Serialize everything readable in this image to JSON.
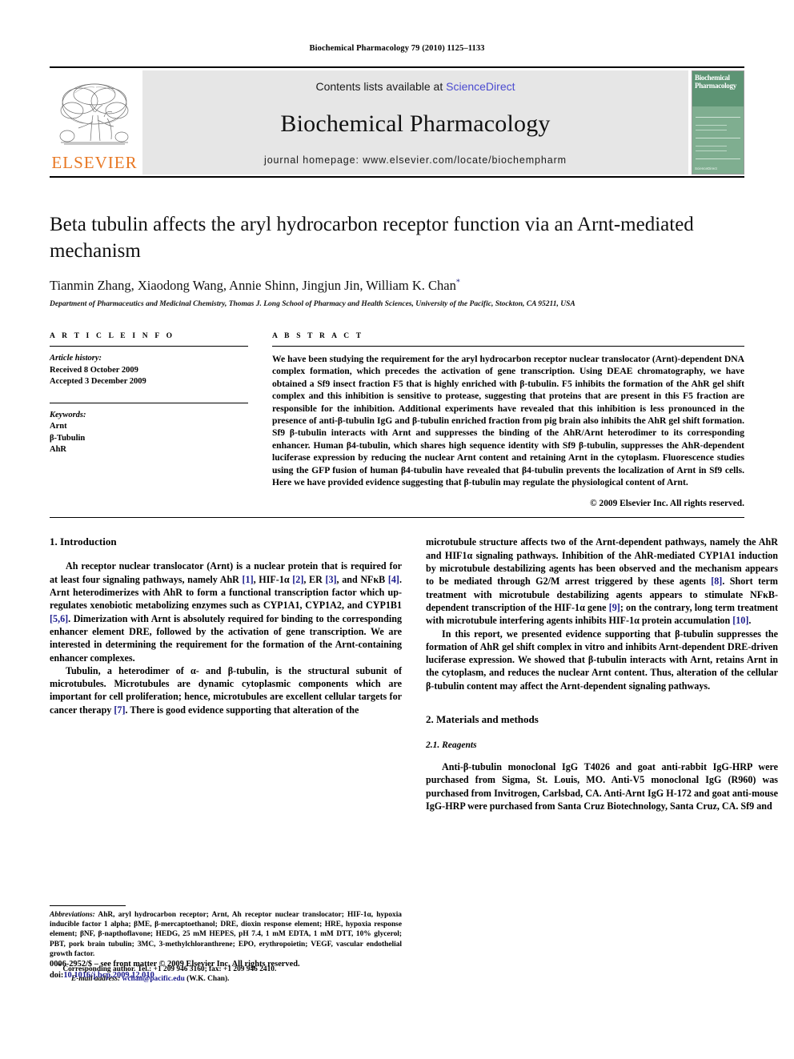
{
  "running_head": "Biochemical Pharmacology 79 (2010) 1125–1133",
  "masthead": {
    "contents_prefix": "Contents lists available at ",
    "sciencedirect": "ScienceDirect",
    "journal_title": "Biochemical Pharmacology",
    "homepage": "journal homepage: www.elsevier.com/locate/biochempharm",
    "publisher_name": "ELSEVIER",
    "cover_title_line1": "Biochemical",
    "cover_title_line2": "Pharmacology",
    "cover_footer": "ScienceDirect",
    "accent_orange": "#E87722",
    "link_blue": "#4a4ad0",
    "cover_green": "#7fae90"
  },
  "article": {
    "title": "Beta tubulin affects the aryl hydrocarbon receptor function via an Arnt-mediated mechanism",
    "authors": "Tianmin Zhang, Xiaodong Wang, Annie Shinn, Jingjun Jin, William K. Chan",
    "corresponding_marker": "*",
    "affiliation": "Department of Pharmaceutics and Medicinal Chemistry, Thomas J. Long School of Pharmacy and Health Sciences, University of the Pacific, Stockton, CA 95211, USA"
  },
  "article_info": {
    "heading": "A R T I C L E  I N F O",
    "history_label": "Article history:",
    "received": "Received 8 October 2009",
    "accepted": "Accepted 3 December 2009",
    "keywords_label": "Keywords:",
    "keywords": [
      "Arnt",
      "β-Tubulin",
      "AhR"
    ]
  },
  "abstract": {
    "heading": "A B S T R A C T",
    "text": "We have been studying the requirement for the aryl hydrocarbon receptor nuclear translocator (Arnt)-dependent DNA complex formation, which precedes the activation of gene transcription. Using DEAE chromatography, we have obtained a Sf9 insect fraction F5 that is highly enriched with β-tubulin. F5 inhibits the formation of the AhR gel shift complex and this inhibition is sensitive to protease, suggesting that proteins that are present in this F5 fraction are responsible for the inhibition. Additional experiments have revealed that this inhibition is less pronounced in the presence of anti-β-tubulin IgG and β-tubulin enriched fraction from pig brain also inhibits the AhR gel shift formation. Sf9 β-tubulin interacts with Arnt and suppresses the binding of the AhR/Arnt heterodimer to its corresponding enhancer. Human β4-tubulin, which shares high sequence identity with Sf9 β-tubulin, suppresses the AhR-dependent luciferase expression by reducing the nuclear Arnt content and retaining Arnt in the cytoplasm. Fluorescence studies using the GFP fusion of human β4-tubulin have revealed that β4-tubulin prevents the localization of Arnt in Sf9 cells. Here we have provided evidence suggesting that β-tubulin may regulate the physiological content of Arnt.",
    "copyright": "© 2009 Elsevier Inc. All rights reserved."
  },
  "sections": {
    "intro_heading": "1. Introduction",
    "intro_p1_a": "Ah receptor nuclear translocator (Arnt) is a nuclear protein that is required for at least four signaling pathways, namely AhR ",
    "intro_p1_r1": "[1]",
    "intro_p1_b": ", HIF-1α ",
    "intro_p1_r2": "[2]",
    "intro_p1_c": ", ER ",
    "intro_p1_r3": "[3]",
    "intro_p1_d": ", and NFκB ",
    "intro_p1_r4": "[4]",
    "intro_p1_e": ". Arnt heterodimerizes with AhR to form a functional transcription factor which up-regulates xenobiotic metabolizing enzymes such as CYP1A1, CYP1A2, and CYP1B1 ",
    "intro_p1_r5": "[5,6]",
    "intro_p1_f": ". Dimerization with Arnt is absolutely required for binding to the corresponding enhancer element DRE, followed by the activation of gene transcription. We are interested in determining the requirement for the formation of the Arnt-containing enhancer complexes.",
    "intro_p2_a": "Tubulin, a heterodimer of α- and β-tubulin, is the structural subunit of microtubules. Microtubules are dynamic cytoplasmic components which are important for cell proliferation; hence, microtubules are excellent cellular targets for cancer therapy ",
    "intro_p2_r1": "[7]",
    "intro_p2_b": ". There is good evidence supporting that alteration of the ",
    "intro_p2_cont_a": "microtubule structure affects two of the Arnt-dependent pathways, namely the AhR and HIF1α signaling pathways. Inhibition of the AhR-mediated CYP1A1 induction by microtubule destabilizing agents has been observed and the mechanism appears to be mediated through G2/M arrest triggered by these agents ",
    "intro_p2_r2": "[8]",
    "intro_p2_c": ". Short term treatment with microtubule destabilizing agents appears to stimulate NFκB-dependent transcription of the HIF-1α gene ",
    "intro_p2_r3": "[9]",
    "intro_p2_d": "; on the contrary, long term treatment with microtubule interfering agents inhibits HIF-1α protein accumulation ",
    "intro_p2_r4": "[10]",
    "intro_p2_e": ".",
    "intro_p3": "In this report, we presented evidence supporting that β-tubulin suppresses the formation of AhR gel shift complex in vitro and inhibits Arnt-dependent DRE-driven luciferase expression. We showed that β-tubulin interacts with Arnt, retains Arnt in the cytoplasm, and reduces the nuclear Arnt content. Thus, alteration of the cellular β-tubulin content may affect the Arnt-dependent signaling pathways.",
    "methods_heading": "2. Materials and methods",
    "reagents_heading": "2.1. Reagents",
    "reagents_p1": "Anti-β-tubulin monoclonal IgG T4026 and goat anti-rabbit IgG-HRP were purchased from Sigma, St. Louis, MO. Anti-V5 monoclonal IgG (R960) was purchased from Invitrogen, Carlsbad, CA. Anti-Arnt IgG H-172 and goat anti-mouse IgG-HRP were purchased from Santa Cruz Biotechnology, Santa Cruz, CA. Sf9 and"
  },
  "footnotes": {
    "abbrev_label": "Abbreviations:",
    "abbrev_text": " AhR, aryl hydrocarbon receptor; Arnt, Ah receptor nuclear translocator; HIF-1α, hypoxia inducible factor 1 alpha; βME, β-mercaptoethanol; DRE, dioxin response element; HRE, hypoxia response element; βNF, β-napthoflavone; HEDG, 25 mM HEPES, pH 7.4, 1 mM EDTA, 1 mM DTT, 10% glycerol; PBT, pork brain tubulin; 3MC, 3-methylchloranthrene; EPO, erythropoietin; VEGF, vascular endothelial growth factor.",
    "corresponding": "Corresponding author. Tel.: +1 209 946 3160; fax: +1 209 946 2410.",
    "email_label": "E-mail address:",
    "email": "wchan@pacific.edu",
    "email_suffix": "(W.K. Chan)."
  },
  "bottom_matter": {
    "issn_line": "0006-2952/$ – see front matter © 2009 Elsevier Inc. All rights reserved.",
    "doi_label": "doi:",
    "doi": "10.1016/j.bcp.2009.12.010"
  }
}
